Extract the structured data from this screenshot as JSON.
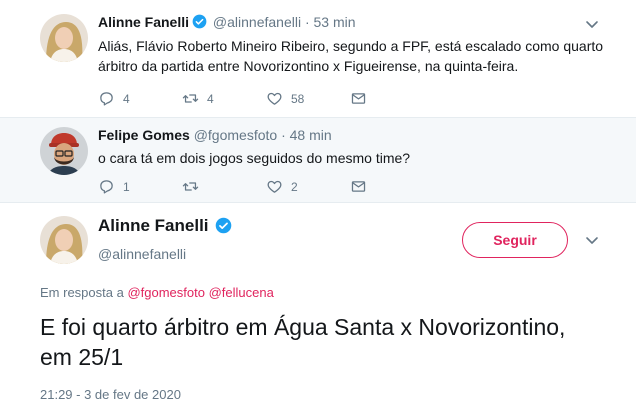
{
  "colors": {
    "accent": "#e0245e",
    "verified": "#1da1f2",
    "muted": "#657786",
    "thread_line": "#f5b4cf"
  },
  "tweets": [
    {
      "name": "Alinne Fanelli",
      "verified": true,
      "handle": "@alinnefanelli",
      "separator": "·",
      "time": "53 min",
      "text": "Aliás, Flávio Roberto Mineiro Ribeiro, segundo a FPF, está escalado como quarto árbitro da partida entre Novorizontino x Figueirense, na quinta-feira.",
      "replies": "4",
      "retweets": "4",
      "likes": "58",
      "icons": [
        "reply-icon",
        "retweet-icon",
        "heart-icon",
        "mail-icon"
      ]
    },
    {
      "name": "Felipe Gomes",
      "verified": false,
      "handle": "@fgomesfoto",
      "separator": "·",
      "time": "48 min",
      "text": "o cara tá em dois jogos seguidos do mesmo time?",
      "replies": "1",
      "retweets": "",
      "likes": "2",
      "icons": [
        "reply-icon",
        "retweet-icon",
        "heart-icon",
        "mail-icon"
      ]
    }
  ],
  "main": {
    "name": "Alinne Fanelli",
    "verified": true,
    "handle": "@alinnefanelli",
    "follow_label": "Seguir",
    "reply_prefix": "Em resposta a",
    "reply_mentions": [
      "@fgomesfoto",
      "@fellucena"
    ],
    "text": "E foi quarto árbitro em Água Santa x Novorizontino, em 25/1",
    "timestamp": "21:29 - 3 de fev de 2020"
  }
}
